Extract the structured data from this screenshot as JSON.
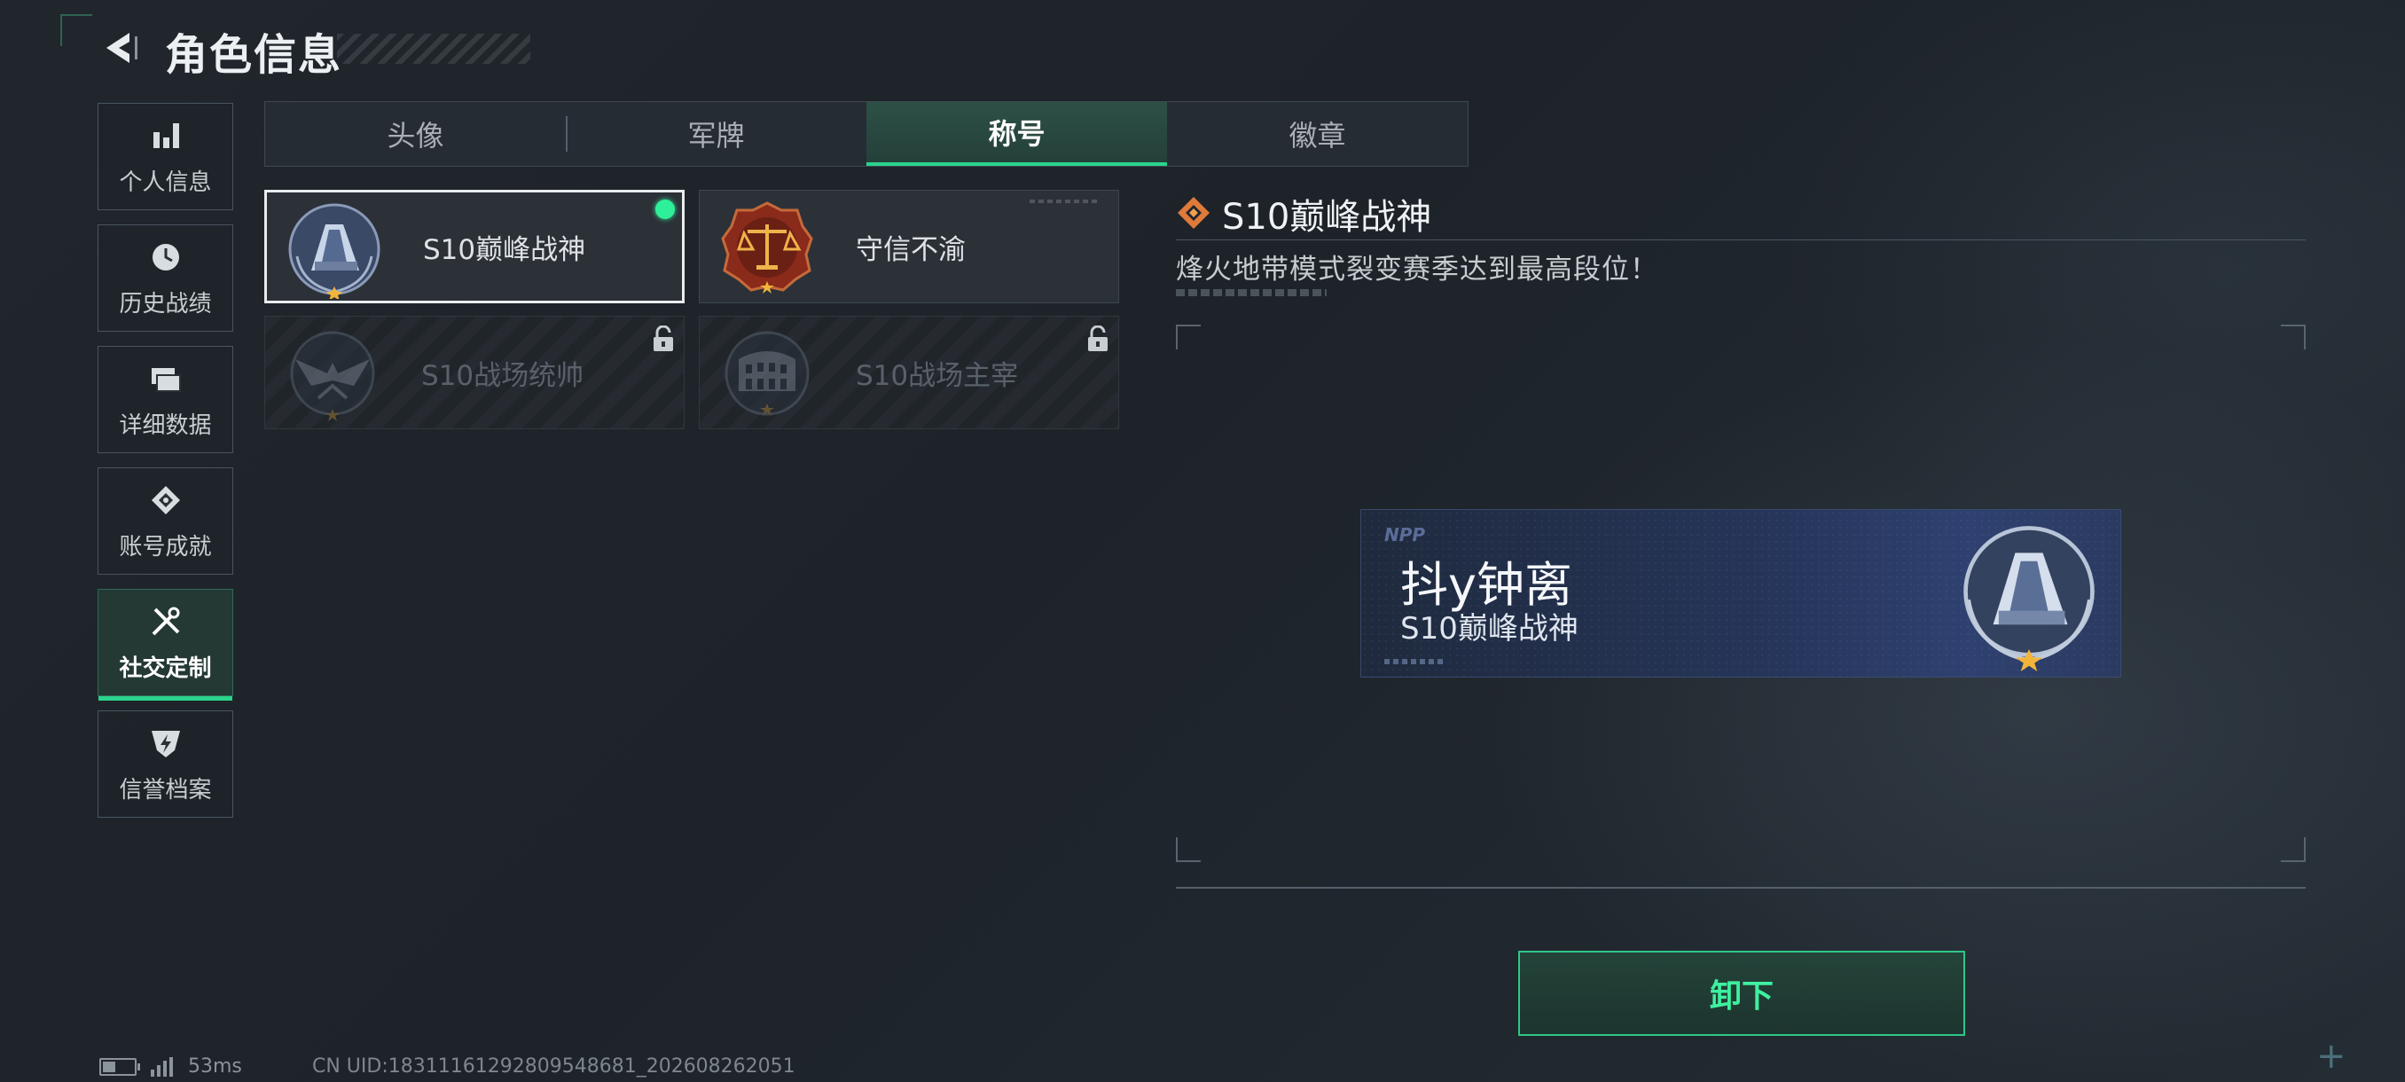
{
  "header": {
    "title": "角色信息",
    "back_icon": "back-arrow-icon"
  },
  "sidebar": {
    "items": [
      {
        "label": "个人信息",
        "icon": "bar-chart-icon",
        "active": false
      },
      {
        "label": "历史战绩",
        "icon": "clock-icon",
        "active": false
      },
      {
        "label": "详细数据",
        "icon": "folders-icon",
        "active": false
      },
      {
        "label": "账号成就",
        "icon": "achievement-icon",
        "active": false
      },
      {
        "label": "社交定制",
        "icon": "tools-icon",
        "active": true
      },
      {
        "label": "信誉档案",
        "icon": "shield-bolt-icon",
        "active": false
      }
    ]
  },
  "tabs": [
    {
      "label": "头像",
      "active": false
    },
    {
      "label": "军牌",
      "active": false
    },
    {
      "label": "称号",
      "active": true
    },
    {
      "label": "徽章",
      "active": false
    }
  ],
  "titles": [
    {
      "label": "S10巅峰战神",
      "icon": "summit-emblem-icon",
      "selected": true,
      "equipped": true,
      "locked": false
    },
    {
      "label": "守信不渝",
      "icon": "scales-emblem-icon",
      "selected": false,
      "equipped": false,
      "locked": false
    },
    {
      "label": "S10战场统帅",
      "icon": "eagle-emblem-icon",
      "selected": false,
      "equipped": false,
      "locked": true
    },
    {
      "label": "S10战场主宰",
      "icon": "colosseum-emblem-icon",
      "selected": false,
      "equipped": false,
      "locked": true
    }
  ],
  "detail": {
    "title": "S10巅峰战神",
    "description": "烽火地带模式裂变赛季达到最高段位！"
  },
  "banner": {
    "player_name": "抖y钟离",
    "title": "S10巅峰战神"
  },
  "actions": {
    "unequip_label": "卸下"
  },
  "status": {
    "ping": "53ms",
    "uid": "CN UID:18311161292809548681_202608262051"
  },
  "colors": {
    "accent": "#2ad48c",
    "equipped_dot": "#2ef09a",
    "background": "#1f252b"
  }
}
